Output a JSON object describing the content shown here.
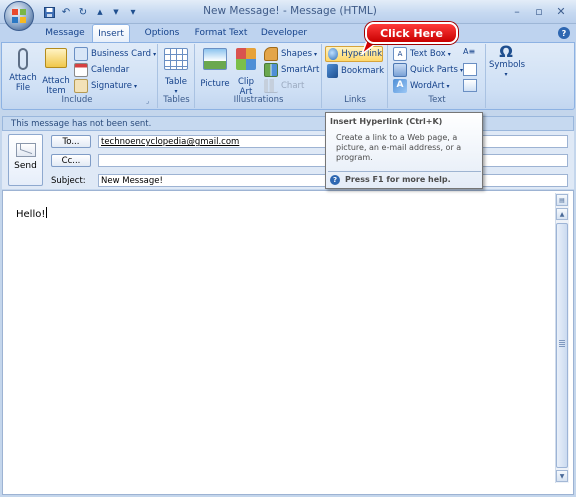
{
  "window": {
    "title": "New Message! - Message (HTML)",
    "minimize": "–",
    "maximize": "▫",
    "close": "✕"
  },
  "quick_access": {
    "save": "save-icon",
    "undo": "↶",
    "redo": "↻",
    "up": "▲",
    "down": "▼",
    "customize": "▾"
  },
  "tabs": [
    "Message",
    "Insert",
    "Options",
    "Format Text",
    "Developer"
  ],
  "active_tab": "Insert",
  "ribbon": {
    "include": {
      "label": "Include",
      "attach_file": [
        "Attach",
        "File"
      ],
      "attach_item": [
        "Attach",
        "Item"
      ],
      "business_card": "Business Card",
      "calendar": "Calendar",
      "signature": "Signature"
    },
    "tables": {
      "label": "Tables",
      "table": "Table"
    },
    "illustrations": {
      "label": "Illustrations",
      "picture": "Picture",
      "clip_art": [
        "Clip",
        "Art"
      ],
      "shapes": "Shapes",
      "smartart": "SmartArt",
      "chart": "Chart"
    },
    "links": {
      "label": "Links",
      "hyperlink": "Hyperlink",
      "bookmark": "Bookmark"
    },
    "text": {
      "label": "Text",
      "text_box": "Text Box",
      "quick_parts": "Quick Parts",
      "wordart": "WordArt"
    },
    "symbols": {
      "symbols": "Symbols",
      "omega": "Ω"
    }
  },
  "callout": {
    "text": "Click Here"
  },
  "info_bar": {
    "text": "This message has not been sent."
  },
  "compose": {
    "send": "Send",
    "to_button": "To...",
    "to_value": "technoencyclopedia@gmail.com",
    "cc_button": "Cc...",
    "cc_value": "",
    "subject_label": "Subject:",
    "subject_value": "New Message!"
  },
  "tooltip": {
    "title": "Insert Hyperlink (Ctrl+K)",
    "body": "Create a link to a Web page, a picture, an e-mail address, or a program.",
    "help_icon": "?",
    "help": "Press F1 for more help."
  },
  "body": {
    "text": "Hello!"
  },
  "colors": {
    "ribbon_blue": "#cfe0f5",
    "text_blue": "#15428b",
    "callout_red": "#d40000",
    "highlight_gold": "#ffd86a"
  }
}
